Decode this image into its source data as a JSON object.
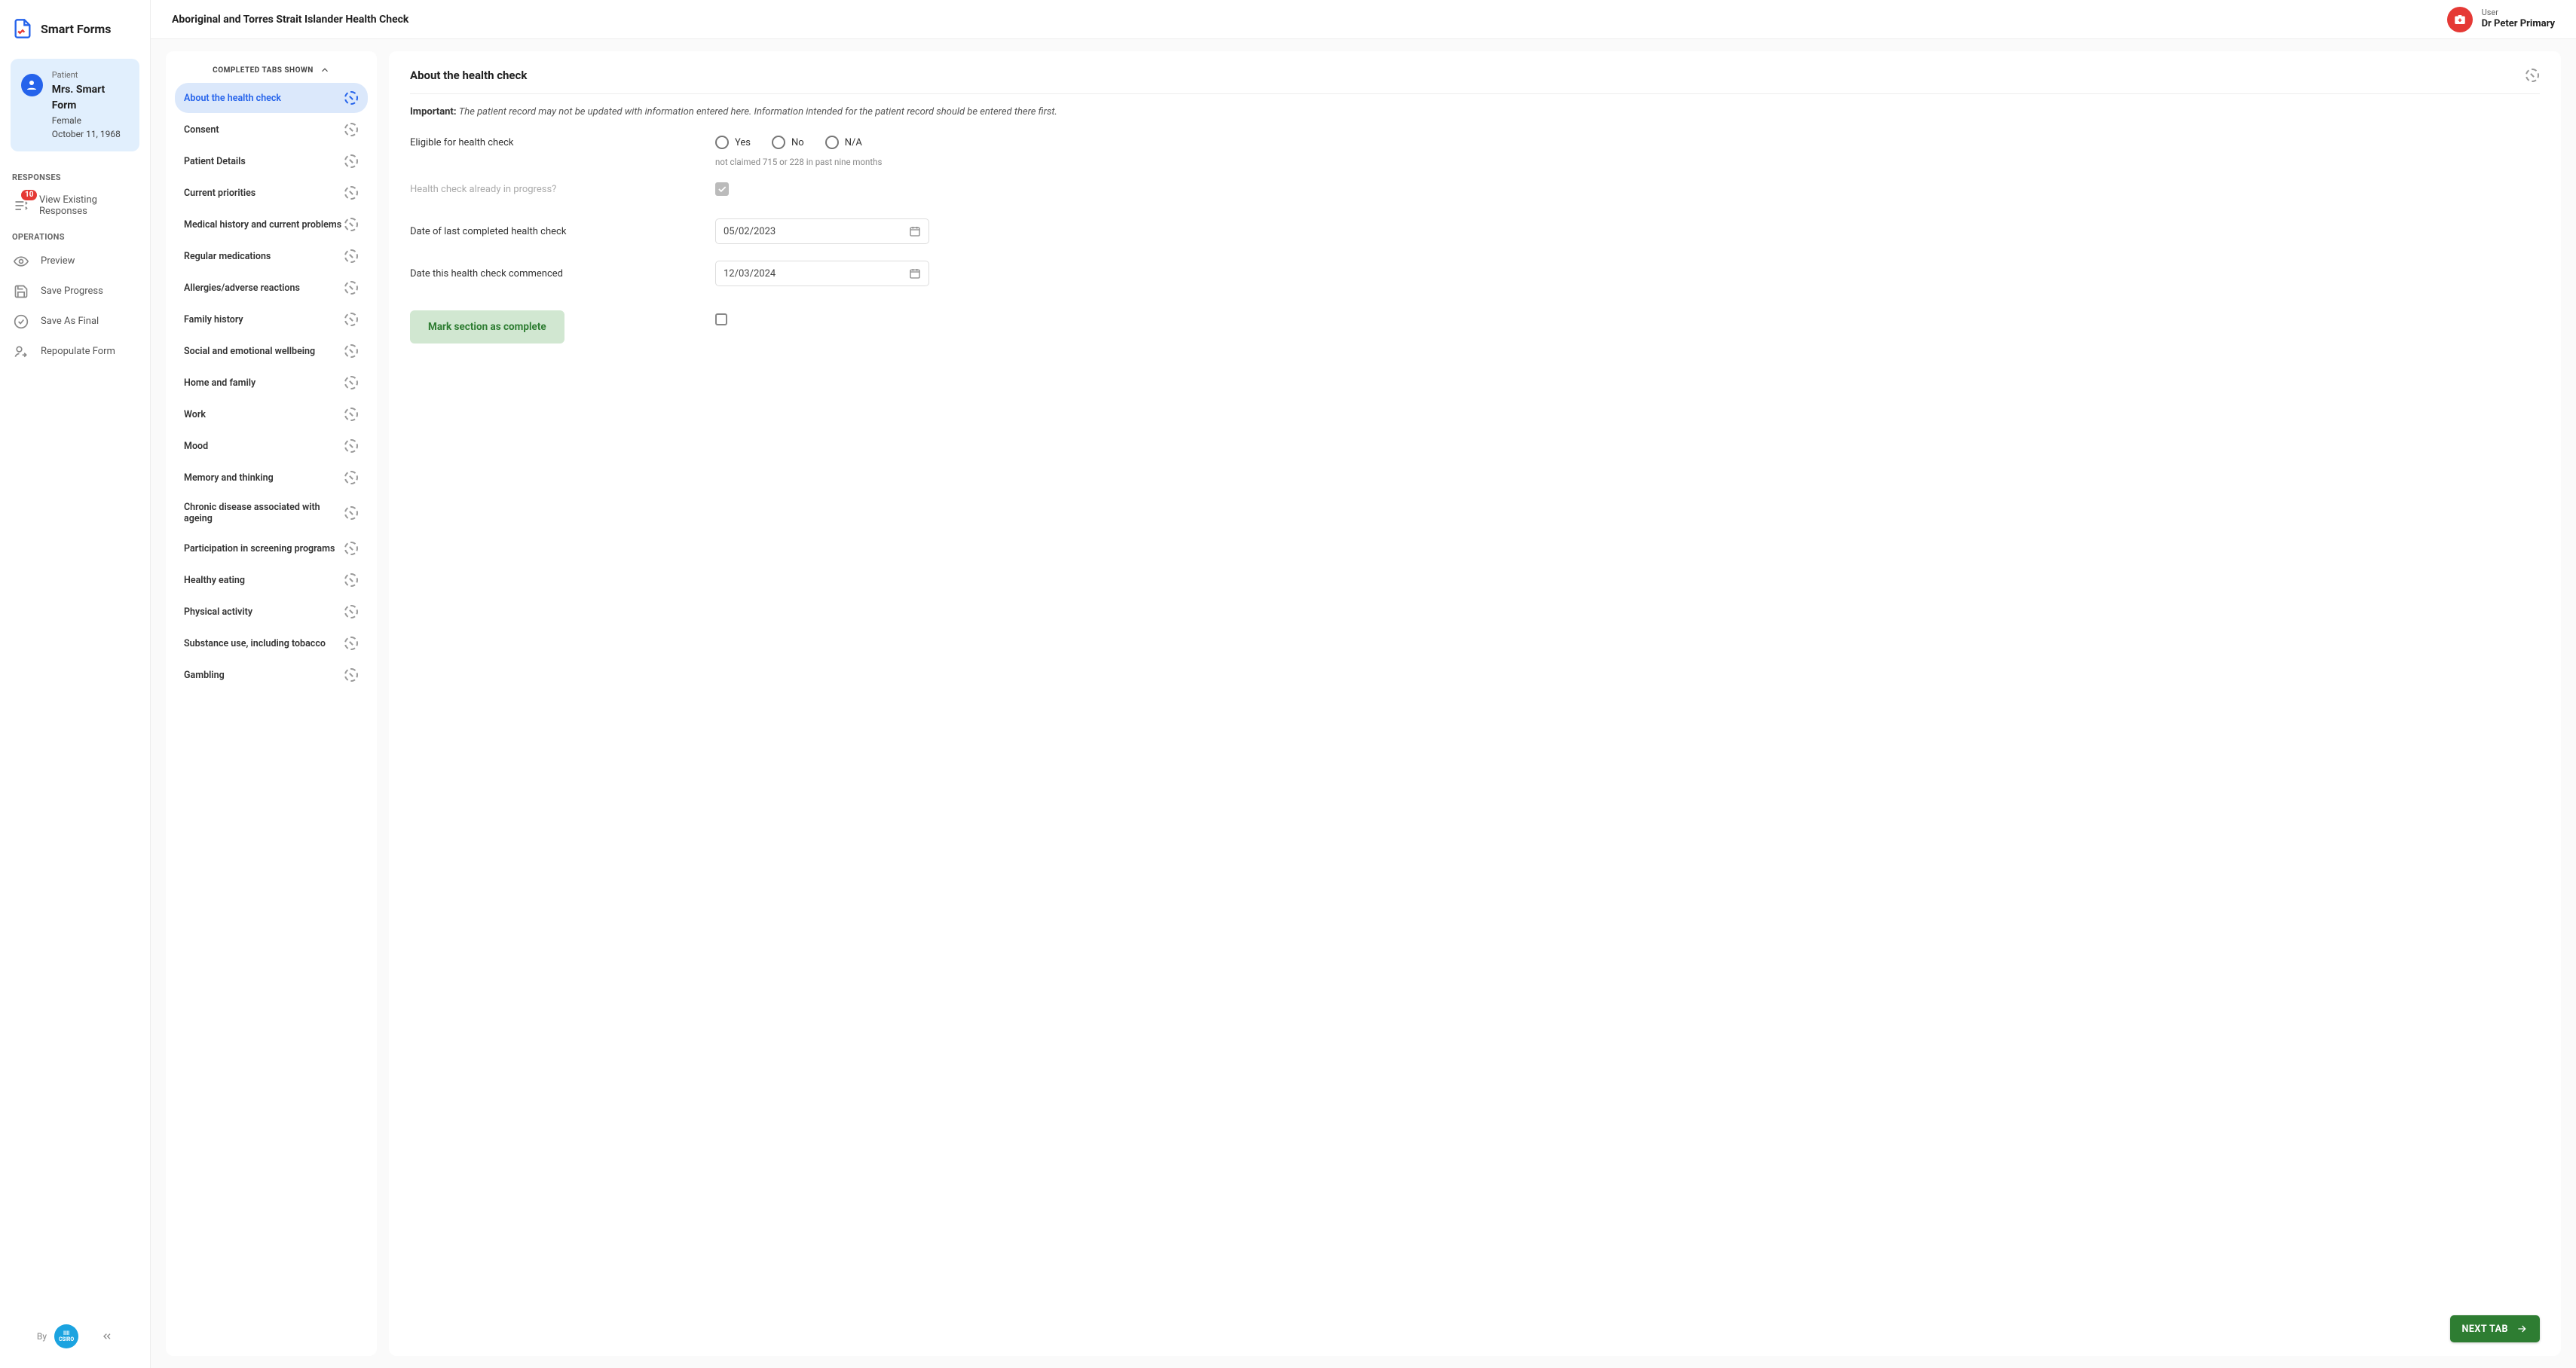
{
  "app": {
    "name": "Smart Forms",
    "by_label": "By",
    "by_org": "CSIRO"
  },
  "header": {
    "title": "Aboriginal and Torres Strait Islander Health Check",
    "user_label": "User",
    "user_name": "Dr Peter Primary"
  },
  "patient": {
    "label": "Patient",
    "name": "Mrs. Smart Form",
    "gender": "Female",
    "dob": "October 11, 1968"
  },
  "sidebar": {
    "responses_header": "RESPONSES",
    "operations_header": "OPERATIONS",
    "view_responses": "View Existing Responses",
    "response_badge": "10",
    "preview": "Preview",
    "save_progress": "Save Progress",
    "save_final": "Save As Final",
    "repopulate": "Repopulate Form"
  },
  "tabs_panel": {
    "header": "COMPLETED TABS SHOWN",
    "items": [
      {
        "label": "About the health check",
        "active": true
      },
      {
        "label": "Consent"
      },
      {
        "label": "Patient Details"
      },
      {
        "label": "Current priorities"
      },
      {
        "label": "Medical history and current problems"
      },
      {
        "label": "Regular medications"
      },
      {
        "label": "Allergies/adverse reactions"
      },
      {
        "label": "Family history"
      },
      {
        "label": "Social and emotional wellbeing"
      },
      {
        "label": "Home and family"
      },
      {
        "label": "Work"
      },
      {
        "label": "Mood"
      },
      {
        "label": "Memory and thinking"
      },
      {
        "label": "Chronic disease associated with ageing"
      },
      {
        "label": "Participation in screening programs"
      },
      {
        "label": "Healthy eating"
      },
      {
        "label": "Physical activity"
      },
      {
        "label": "Substance use, including tobacco"
      },
      {
        "label": "Gambling"
      }
    ]
  },
  "form": {
    "title": "About the health check",
    "important_label": "Important:",
    "important_text": "The patient record may not be updated with information entered here. Information intended for the patient record should be entered there first.",
    "eligible_label": "Eligible for health check",
    "eligible_hint": "not claimed 715 or 228 in past nine months",
    "radio_yes": "Yes",
    "radio_no": "No",
    "radio_na": "N/A",
    "in_progress_label": "Health check already in progress?",
    "in_progress_checked": true,
    "last_completed_label": "Date of last completed health check",
    "last_completed_value": "05/02/2023",
    "commenced_label": "Date this health check commenced",
    "commenced_value": "12/03/2024",
    "mark_complete_label": "Mark section as complete",
    "next_tab_label": "NEXT TAB"
  }
}
